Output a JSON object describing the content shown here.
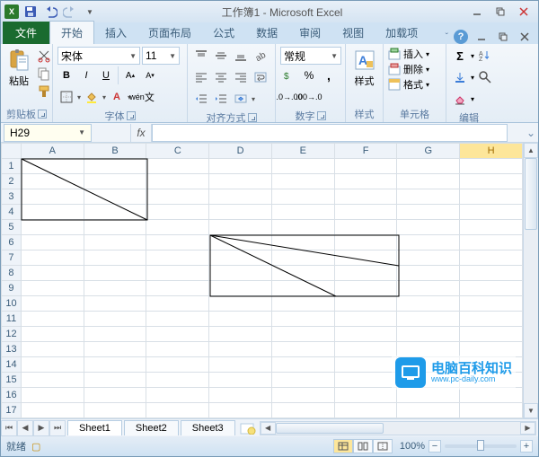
{
  "title": "工作簿1 - Microsoft Excel",
  "appIconLetter": "X",
  "tabs": {
    "file": "文件",
    "home": "开始",
    "insert": "插入",
    "layout": "页面布局",
    "formulas": "公式",
    "data": "数据",
    "review": "审阅",
    "view": "视图",
    "addins": "加载项"
  },
  "ribbon": {
    "clipboard": {
      "label": "剪贴板",
      "paste": "粘贴"
    },
    "font": {
      "label": "字体",
      "name": "宋体",
      "size": "11",
      "bold": "B",
      "italic": "I",
      "underline": "U"
    },
    "alignment": {
      "label": "对齐方式"
    },
    "number": {
      "label": "数字",
      "format": "常规"
    },
    "styles": {
      "label": "样式",
      "btn": "样式"
    },
    "cells": {
      "label": "单元格",
      "insert": "插入",
      "delete": "删除",
      "format": "格式"
    },
    "editing": {
      "label": "编辑"
    }
  },
  "namebox": "H29",
  "fx": "fx",
  "columns": [
    "A",
    "B",
    "C",
    "D",
    "E",
    "F",
    "G",
    "H"
  ],
  "rows": [
    "1",
    "2",
    "3",
    "4",
    "5",
    "6",
    "7",
    "8",
    "9",
    "10",
    "11",
    "12",
    "13",
    "14",
    "15",
    "16",
    "17"
  ],
  "selectedCol": "H",
  "sheets": {
    "s1": "Sheet1",
    "s2": "Sheet2",
    "s3": "Sheet3"
  },
  "status": "就绪",
  "zoom": "100%",
  "watermark": {
    "cn": "电脑百科知识",
    "en": "www.pc-daily.com"
  },
  "chart_data": null
}
